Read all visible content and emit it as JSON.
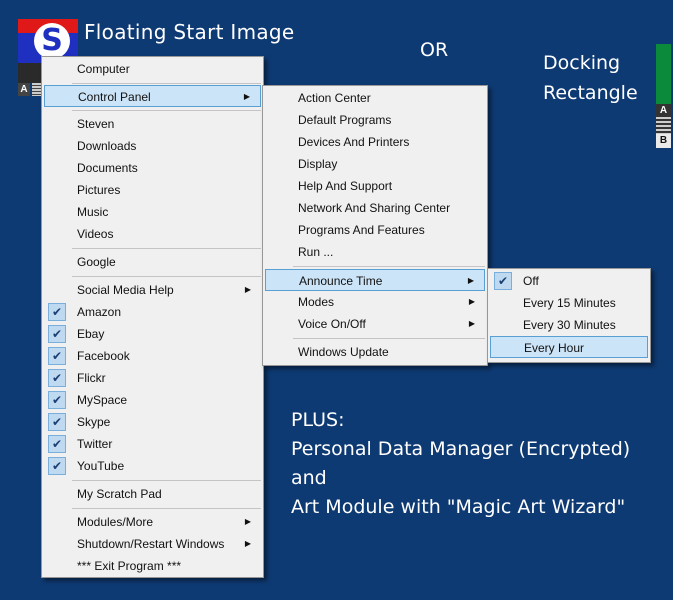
{
  "labels": {
    "floating_start": "Floating Start Image",
    "or": "OR",
    "docking_1": "Docking",
    "docking_2": "Rectangle",
    "plus_1": "PLUS:",
    "plus_2": "Personal Data Manager (Encrypted)",
    "plus_3": "and",
    "plus_4": "Art Module with \"Magic Art Wizard\"",
    "start_letter": "S",
    "a_letter": "A",
    "b_letter": "B"
  },
  "colors": {
    "background": "#0e3a73",
    "highlight": "#cce4f7",
    "dock_green": "#0b8a3c"
  },
  "main_menu": {
    "computer": "Computer",
    "control_panel": "Control Panel",
    "steven": "Steven",
    "downloads": "Downloads",
    "documents": "Documents",
    "pictures": "Pictures",
    "music": "Music",
    "videos": "Videos",
    "google": "Google",
    "social_media_help": "Social Media Help",
    "amazon": "Amazon",
    "ebay": "Ebay",
    "facebook": "Facebook",
    "flickr": "Flickr",
    "myspace": "MySpace",
    "skype": "Skype",
    "twitter": "Twitter",
    "youtube": "YouTube",
    "scratch_pad": "My Scratch Pad",
    "modules_more": "Modules/More",
    "shutdown_restart": "Shutdown/Restart Windows",
    "exit_program": "*** Exit Program ***"
  },
  "control_panel_menu": {
    "action_center": "Action Center",
    "default_programs": "Default Programs",
    "devices_printers": "Devices And Printers",
    "display": "Display",
    "help_support": "Help And Support",
    "network_sharing": "Network And Sharing Center",
    "programs_features": "Programs And Features",
    "run": "Run ...",
    "announce_time": "Announce Time",
    "modes": "Modes",
    "voice_onoff": "Voice On/Off",
    "windows_update": "Windows Update"
  },
  "announce_menu": {
    "off": "Off",
    "every_15": "Every 15 Minutes",
    "every_30": "Every 30 Minutes",
    "every_hour": "Every Hour"
  },
  "icons": {
    "check": "✔",
    "arrow": "▶"
  }
}
